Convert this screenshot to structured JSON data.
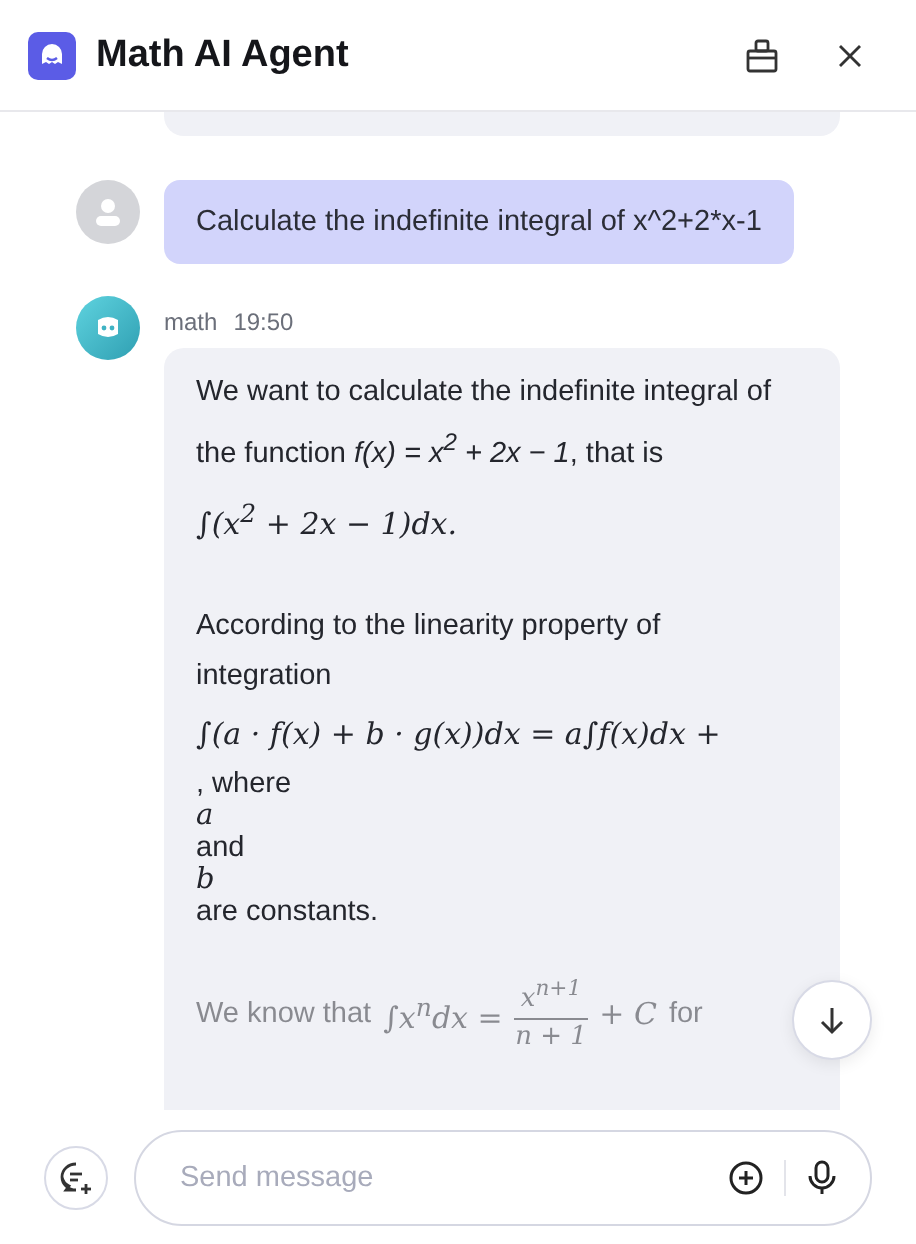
{
  "header": {
    "title": "Math AI Agent"
  },
  "messages": [
    {
      "kind": "clipped"
    },
    {
      "kind": "user",
      "text": "Calculate the indefinite integral of x^2+2*x-1"
    },
    {
      "kind": "bot",
      "sender": "math",
      "time": "19:50",
      "blocks": [
        {
          "kind": "paragraph",
          "text": "We want to calculate the indefinite integral of the function *f(x) = x$^{2}$ + 2x − 1*, that is"
        },
        {
          "kind": "formula",
          "text": "∫(x$^{2}$ + 2x − 1)dx."
        },
        {
          "kind": "gap"
        },
        {
          "kind": "paragraph",
          "text": "According to the linearity property of integration"
        },
        {
          "kind": "formula",
          "text": "∫(a · f(x) + b · g(x))dx = a∫f(x)dx +"
        },
        {
          "kind": "line",
          "text": ", where"
        },
        {
          "kind": "math-line",
          "text": "a"
        },
        {
          "kind": "line",
          "text": "and"
        },
        {
          "kind": "math-line",
          "text": "b"
        },
        {
          "kind": "line",
          "text": "are constants."
        },
        {
          "kind": "gap"
        },
        {
          "kind": "faded",
          "before": "We know that",
          "formula": "∫x$^{n}$dx =",
          "numerator": "x$^{n+1}$",
          "denominator": "n + 1",
          "after_formula": "+ C",
          "after": "for"
        }
      ]
    }
  ],
  "input": {
    "placeholder": "Send message"
  }
}
